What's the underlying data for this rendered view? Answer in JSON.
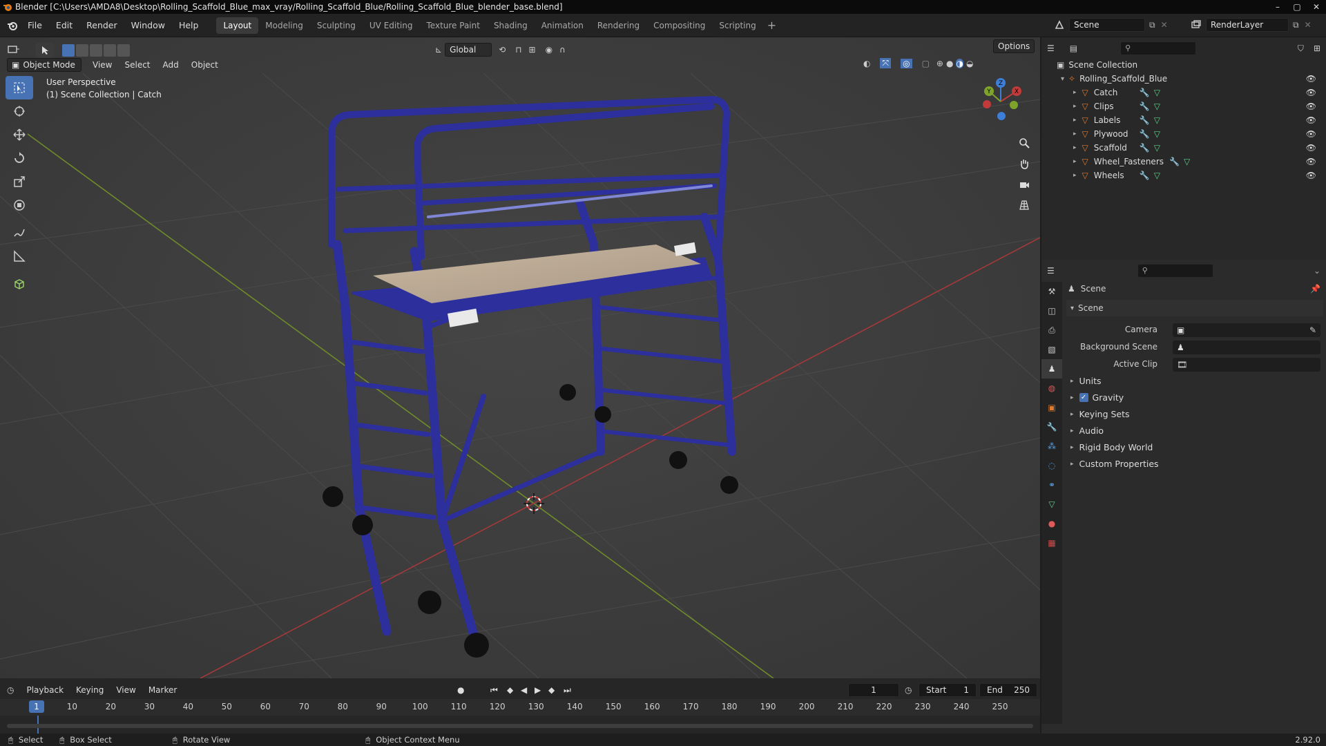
{
  "title_bar": {
    "text": "Blender [C:\\Users\\AMDA8\\Desktop\\Rolling_Scaffold_Blue_max_vray/Rolling_Scaffold_Blue/Rolling_Scaffold_Blue_blender_base.blend]"
  },
  "menus": [
    "File",
    "Edit",
    "Render",
    "Window",
    "Help"
  ],
  "workspaces": [
    "Layout",
    "Modeling",
    "Sculpting",
    "UV Editing",
    "Texture Paint",
    "Shading",
    "Animation",
    "Rendering",
    "Compositing",
    "Scripting"
  ],
  "active_workspace": "Layout",
  "scene_field": "Scene",
  "renderlayer_field": "RenderLayer",
  "viewport": {
    "mode": "Object Mode",
    "menu": [
      "View",
      "Select",
      "Add",
      "Object"
    ],
    "transform_orientation": "Global",
    "options_label": "Options",
    "overlay_line1": "User Perspective",
    "overlay_line2": "(1) Scene Collection | Catch",
    "gizmo": {
      "x": "X",
      "y": "Y",
      "z": "Z"
    }
  },
  "outliner": {
    "root": "Scene Collection",
    "collection": "Rolling_Scaffold_Blue",
    "items": [
      "Catch",
      "Clips",
      "Labels",
      "Plywood",
      "Scaffold",
      "Wheel_Fasteners",
      "Wheels"
    ]
  },
  "properties": {
    "header": "Scene",
    "panel_title": "Scene",
    "fields": [
      {
        "label": "Camera"
      },
      {
        "label": "Background Scene"
      },
      {
        "label": "Active Clip"
      }
    ],
    "panels": [
      {
        "label": "Units",
        "checkbox": false
      },
      {
        "label": "Gravity",
        "checkbox": true
      },
      {
        "label": "Keying Sets",
        "checkbox": false
      },
      {
        "label": "Audio",
        "checkbox": false
      },
      {
        "label": "Rigid Body World",
        "checkbox": false
      },
      {
        "label": "Custom Properties",
        "checkbox": false
      }
    ]
  },
  "timeline": {
    "menus": [
      "Playback",
      "Keying",
      "View",
      "Marker"
    ],
    "current_frame": "1",
    "start_label": "Start",
    "start": "1",
    "end_label": "End",
    "end": "250",
    "ticks": [
      "1",
      "10",
      "20",
      "30",
      "40",
      "50",
      "60",
      "70",
      "80",
      "90",
      "100",
      "110",
      "120",
      "130",
      "140",
      "150",
      "160",
      "170",
      "180",
      "190",
      "200",
      "210",
      "220",
      "230",
      "240",
      "250"
    ],
    "current_marker": "1"
  },
  "statusbar": {
    "select": "Select",
    "box_select": "Box Select",
    "rotate": "Rotate View",
    "context": "Object Context Menu",
    "version": "2.92.0"
  },
  "colors": {
    "accent": "#4772b3",
    "scaffold": "#2c2f9c",
    "x_axis": "#c23a3a",
    "y_axis": "#7ea32a",
    "z_axis": "#3d7fd6",
    "object_orange": "#e07a2e"
  }
}
